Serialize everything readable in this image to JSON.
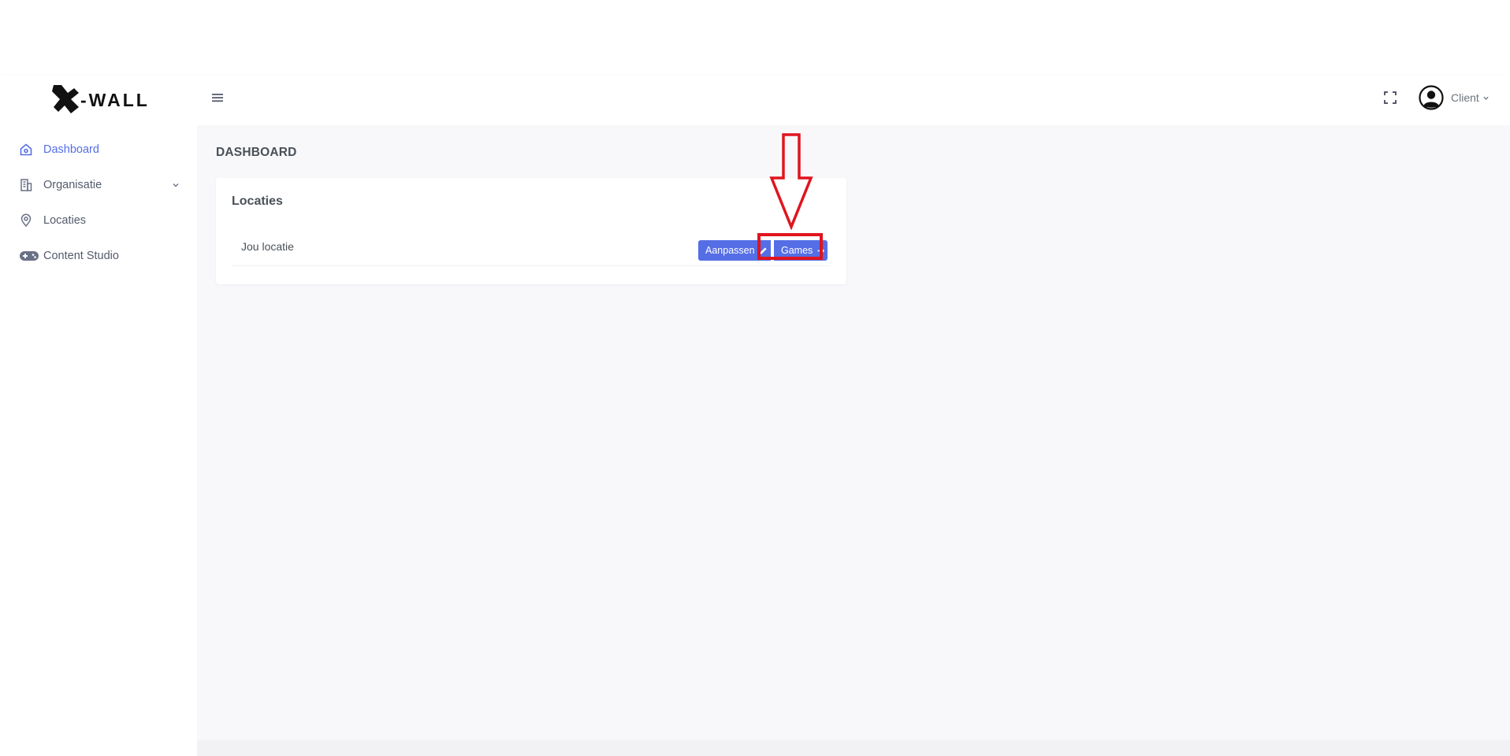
{
  "header": {
    "logo_text": "-WALL",
    "user": {
      "name": "Client"
    }
  },
  "sidebar": {
    "items": [
      {
        "label": "Dashboard",
        "icon": "home-icon",
        "active": true
      },
      {
        "label": "Organisatie",
        "icon": "building-icon",
        "expandable": true
      },
      {
        "label": "Locaties",
        "icon": "map-pin-icon"
      },
      {
        "label": "Content Studio",
        "icon": "gamepad-icon"
      }
    ]
  },
  "main": {
    "page_title": "DASHBOARD",
    "card": {
      "title": "Locaties",
      "rows": [
        {
          "label": "Jou locatie",
          "edit_label": "Aanpassen",
          "games_label": "Games"
        }
      ]
    }
  },
  "colors": {
    "accent": "#556ee6",
    "annotation": "#e0141e",
    "background": "#f8f8fb",
    "text": "#495057"
  }
}
